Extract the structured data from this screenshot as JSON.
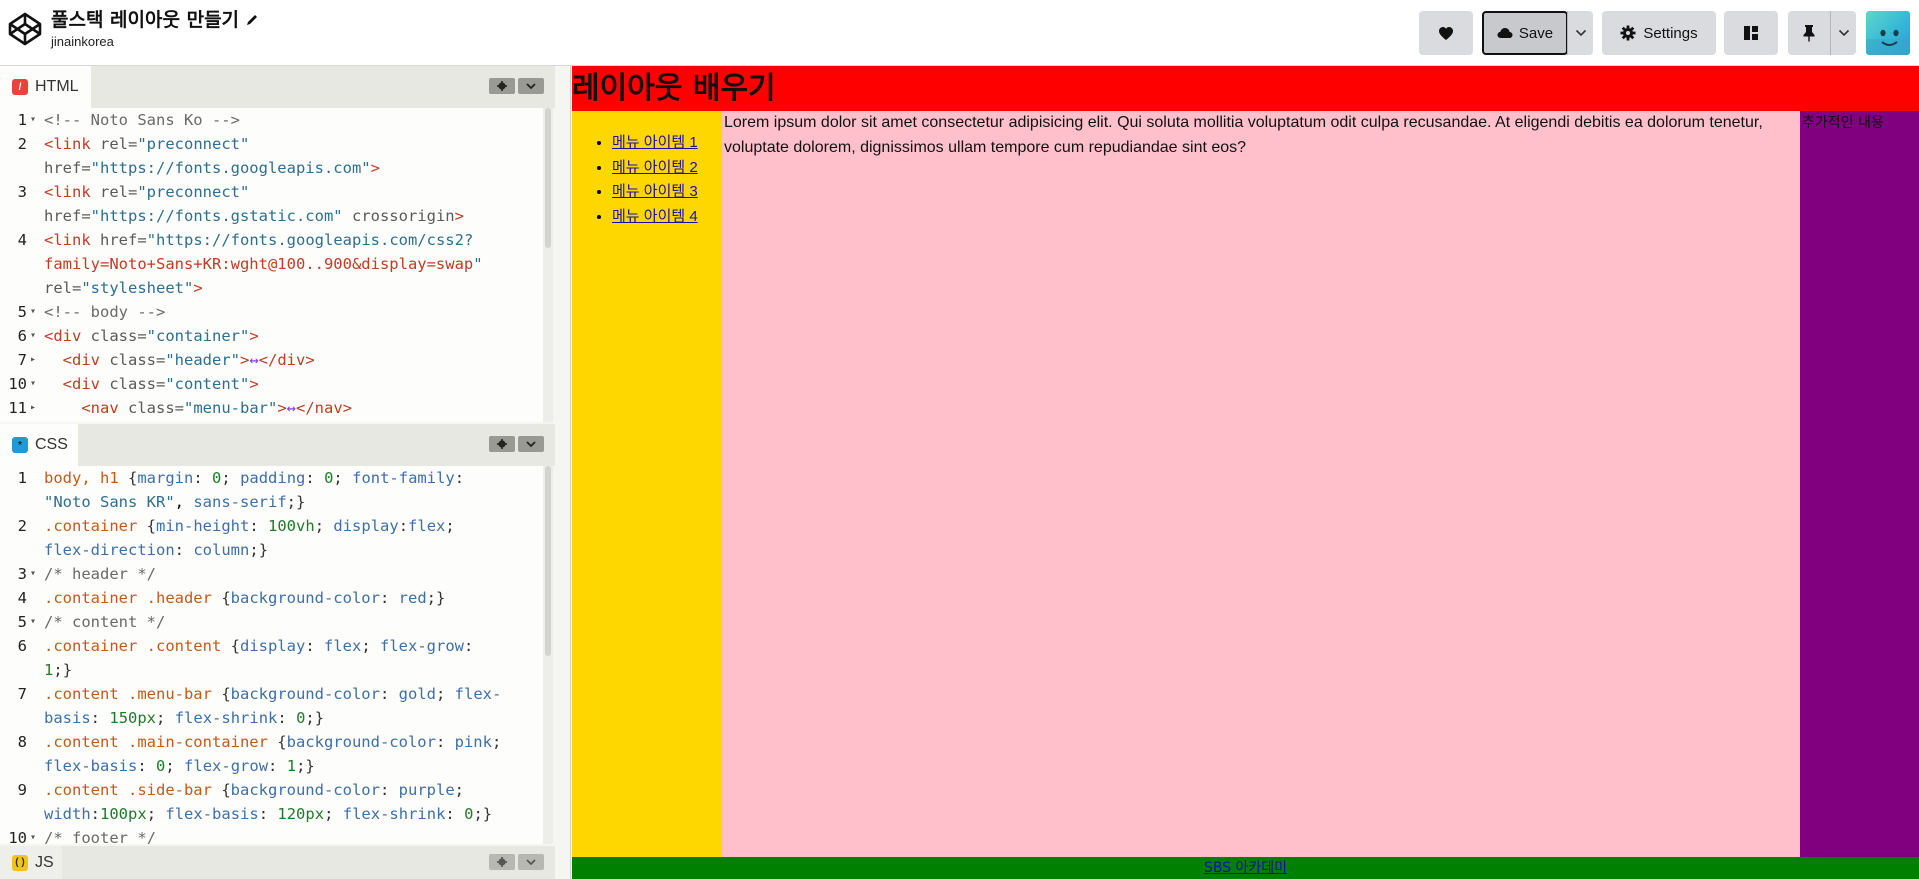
{
  "app": {
    "pen_title": "풀스택 레이아웃 만들기",
    "owner": "jinainkorea"
  },
  "toolbar": {
    "save_label": "Save",
    "settings_label": "Settings"
  },
  "editors": {
    "html_tab": "HTML",
    "css_tab": "CSS",
    "js_tab": "JS",
    "html_lines": [
      {
        "n": "1",
        "fold": "▾",
        "t": "<!-- Noto Sans Ko -->"
      },
      {
        "n": "2",
        "fold": "",
        "t": "<link rel=\"preconnect\""
      },
      {
        "n": "",
        "fold": "",
        "t": "href=\"https://fonts.googleapis.com\">"
      },
      {
        "n": "3",
        "fold": "",
        "t": "<link rel=\"preconnect\""
      },
      {
        "n": "",
        "fold": "",
        "t": "href=\"https://fonts.gstatic.com\" crossorigin>"
      },
      {
        "n": "4",
        "fold": "",
        "t": "<link href=\"https://fonts.googleapis.com/css2?"
      },
      {
        "n": "",
        "fold": "",
        "t": "family=Noto+Sans+KR:wght@100..900&display=swap\""
      },
      {
        "n": "",
        "fold": "",
        "t": "rel=\"stylesheet\">"
      },
      {
        "n": "5",
        "fold": "▾",
        "t": "<!-- body -->"
      },
      {
        "n": "6",
        "fold": "▾",
        "t": "<div class=\"container\">"
      },
      {
        "n": "7",
        "fold": "▸",
        "t": "  <div class=\"header\">↔</div>"
      },
      {
        "n": "10",
        "fold": "▾",
        "t": "  <div class=\"content\">"
      },
      {
        "n": "11",
        "fold": "▸",
        "t": "    <nav class=\"menu-bar\">↔</nav>"
      }
    ],
    "css_lines": [
      {
        "n": "1",
        "fold": "",
        "t": "body, h1 {margin: 0; padding: 0; font-family:"
      },
      {
        "n": "",
        "fold": "",
        "t": "\"Noto Sans KR\", sans-serif;}"
      },
      {
        "n": "2",
        "fold": "",
        "t": ".container {min-height: 100vh; display:flex;"
      },
      {
        "n": "",
        "fold": "",
        "t": "flex-direction: column;}"
      },
      {
        "n": "3",
        "fold": "▾",
        "t": "/* header */"
      },
      {
        "n": "4",
        "fold": "",
        "t": ".container .header {background-color: red;}"
      },
      {
        "n": "5",
        "fold": "▾",
        "t": "/* content */"
      },
      {
        "n": "6",
        "fold": "",
        "t": ".container .content {display: flex; flex-grow:"
      },
      {
        "n": "",
        "fold": "",
        "t": "1;}"
      },
      {
        "n": "7",
        "fold": "",
        "t": ".content .menu-bar {background-color: gold; flex-"
      },
      {
        "n": "",
        "fold": "",
        "t": "basis: 150px; flex-shrink: 0;}"
      },
      {
        "n": "8",
        "fold": "",
        "t": ".content .main-container {background-color: pink;"
      },
      {
        "n": "",
        "fold": "",
        "t": "flex-basis: 0; flex-grow: 1;}"
      },
      {
        "n": "9",
        "fold": "",
        "t": ".content .side-bar {background-color: purple;"
      },
      {
        "n": "",
        "fold": "",
        "t": "width:100px; flex-basis: 120px; flex-shrink: 0;}"
      },
      {
        "n": "10",
        "fold": "▾",
        "t": "/* footer */"
      }
    ]
  },
  "preview": {
    "header_title": "레이아웃 배우기",
    "menu_items": [
      "메뉴 아이템 1",
      "메뉴 아이템 2",
      "메뉴 아이템 3",
      "메뉴 아이템 4"
    ],
    "main_text": "Lorem ipsum dolor sit amet consectetur adipisicing elit. Qui soluta mollitia voluptatum odit culpa recusandae. At eligendi debitis ea dolorum tenetur, voluptate dolorem, dignissimos ullam tempore cum repudiandae sint eos?",
    "side_text": "추가적인 내용",
    "footer_link": "SBS 아카데미"
  },
  "colors": {
    "header_bg": "#ff0000",
    "menu_bg": "#ffd700",
    "main_bg": "#ffc0cb",
    "side_bg": "#800080",
    "footer_bg": "#008000",
    "html_tab_icon": "#e8433d",
    "css_tab_icon": "#1f9ad6",
    "js_tab_icon": "#f0c419"
  }
}
